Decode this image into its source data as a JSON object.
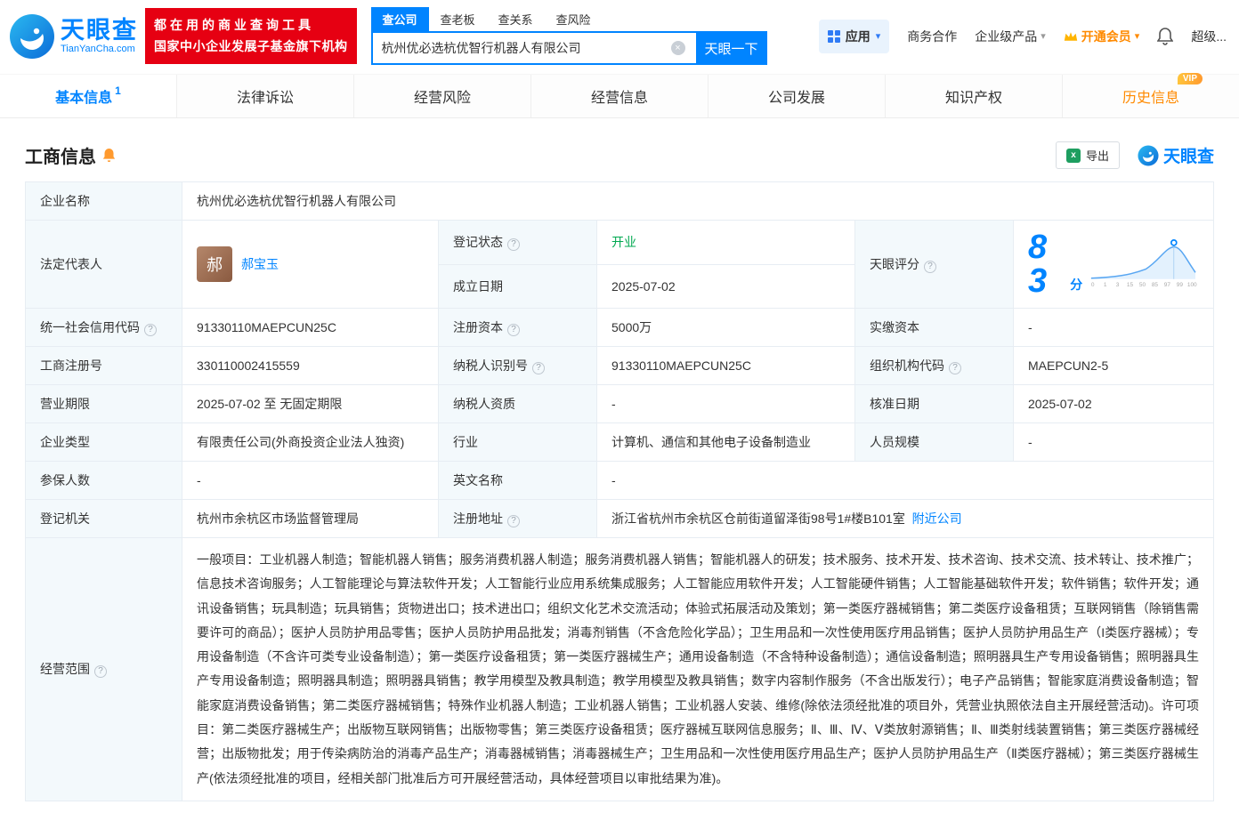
{
  "colors": {
    "brand_blue": "#0084ff",
    "brand_red": "#e60012",
    "vip_orange": "#ff8a00",
    "status_green": "#00a850"
  },
  "header": {
    "logo": {
      "title": "天眼查",
      "subtitle": "TianYanCha.com"
    },
    "slogan": {
      "line1": "都在用的商业查询工具",
      "line2": "国家中小企业发展子基金旗下机构"
    },
    "search": {
      "tabs": [
        {
          "label": "查公司"
        },
        {
          "label": "查老板"
        },
        {
          "label": "查关系"
        },
        {
          "label": "查风险"
        }
      ],
      "value": "杭州优必选杭优智行机器人有限公司",
      "button": "天眼一下",
      "clear": "×"
    },
    "right": {
      "apps": "应用",
      "cooperation": "商务合作",
      "enterprise": "企业级产品",
      "vip": "开通会员",
      "super": "超级..."
    }
  },
  "nav": {
    "tabs": [
      {
        "label": "基本信息",
        "badge": "1"
      },
      {
        "label": "法律诉讼"
      },
      {
        "label": "经营风险"
      },
      {
        "label": "经营信息"
      },
      {
        "label": "公司发展"
      },
      {
        "label": "知识产权"
      },
      {
        "label": "历史信息",
        "tag": "VIP"
      }
    ]
  },
  "section": {
    "title": "工商信息",
    "export_label": "导出",
    "logo_text": "天眼查"
  },
  "score": {
    "label": "天眼评分",
    "value": "83",
    "unit": "分",
    "axis": [
      "0",
      "1",
      "3",
      "15",
      "50",
      "85",
      "97",
      "99",
      "100"
    ]
  },
  "fields": {
    "company_name": {
      "label": "企业名称",
      "value": "杭州优必选杭优智行机器人有限公司"
    },
    "legal_rep": {
      "label": "法定代表人",
      "value": "郝宝玉",
      "avatar": "郝"
    },
    "reg_status": {
      "label": "登记状态",
      "value": "开业"
    },
    "establish_date": {
      "label": "成立日期",
      "value": "2025-07-02"
    },
    "credit_code": {
      "label": "统一社会信用代码",
      "value": "91330110MAEPCUN25C"
    },
    "reg_capital": {
      "label": "注册资本",
      "value": "5000万"
    },
    "paid_capital": {
      "label": "实缴资本",
      "value": "-"
    },
    "reg_number": {
      "label": "工商注册号",
      "value": "330110002415559"
    },
    "taxpayer_id": {
      "label": "纳税人识别号",
      "value": "91330110MAEPCUN25C"
    },
    "org_code": {
      "label": "组织机构代码",
      "value": "MAEPCUN2-5"
    },
    "business_term": {
      "label": "营业期限",
      "value": "2025-07-02 至 无固定期限"
    },
    "taxpayer_quality": {
      "label": "纳税人资质",
      "value": "-"
    },
    "approval_date": {
      "label": "核准日期",
      "value": "2025-07-02"
    },
    "company_type": {
      "label": "企业类型",
      "value": "有限责任公司(外商投资企业法人独资)"
    },
    "industry": {
      "label": "行业",
      "value": "计算机、通信和其他电子设备制造业"
    },
    "staff_size": {
      "label": "人员规模",
      "value": "-"
    },
    "insured_count": {
      "label": "参保人数",
      "value": "-"
    },
    "english_name": {
      "label": "英文名称",
      "value": "-"
    },
    "reg_authority": {
      "label": "登记机关",
      "value": "杭州市余杭区市场监督管理局"
    },
    "address": {
      "label": "注册地址",
      "value": "浙江省杭州市余杭区仓前街道留泽街98号1#楼B101室",
      "link": "附近公司"
    },
    "business_scope": {
      "label": "经营范围",
      "value": "一般项目：工业机器人制造；智能机器人销售；服务消费机器人制造；服务消费机器人销售；智能机器人的研发；技术服务、技术开发、技术咨询、技术交流、技术转让、技术推广；信息技术咨询服务；人工智能理论与算法软件开发；人工智能行业应用系统集成服务；人工智能应用软件开发；人工智能硬件销售；人工智能基础软件开发；软件销售；软件开发；通讯设备销售；玩具制造；玩具销售；货物进出口；技术进出口；组织文化艺术交流活动；体验式拓展活动及策划；第一类医疗器械销售；第二类医疗设备租赁；互联网销售（除销售需要许可的商品）；医护人员防护用品零售；医护人员防护用品批发；消毒剂销售（不含危险化学品）；卫生用品和一次性使用医疗用品销售；医护人员防护用品生产（I类医疗器械）；专用设备制造（不含许可类专业设备制造）；第一类医疗设备租赁；第一类医疗器械生产；通用设备制造（不含特种设备制造）；通信设备制造；照明器具生产专用设备销售；照明器具生产专用设备制造；照明器具制造；照明器具销售；教学用模型及教具制造；教学用模型及教具销售；数字内容制作服务（不含出版发行）；电子产品销售；智能家庭消费设备制造；智能家庭消费设备销售；第二类医疗器械销售；特殊作业机器人制造；工业机器人销售；工业机器人安装、维修(除依法须经批准的项目外，凭营业执照依法自主开展经营活动)。许可项目：第二类医疗器械生产；出版物互联网销售；出版物零售；第三类医疗设备租赁；医疗器械互联网信息服务；Ⅱ、Ⅲ、Ⅳ、Ⅴ类放射源销售；Ⅱ、Ⅲ类射线装置销售；第三类医疗器械经营；出版物批发；用于传染病防治的消毒产品生产；消毒器械销售；消毒器械生产；卫生用品和一次性使用医疗用品生产；医护人员防护用品生产（Ⅱ类医疗器械）；第三类医疗器械生产(依法须经批准的项目，经相关部门批准后方可开展经营活动，具体经营项目以审批结果为准)。"
    }
  }
}
